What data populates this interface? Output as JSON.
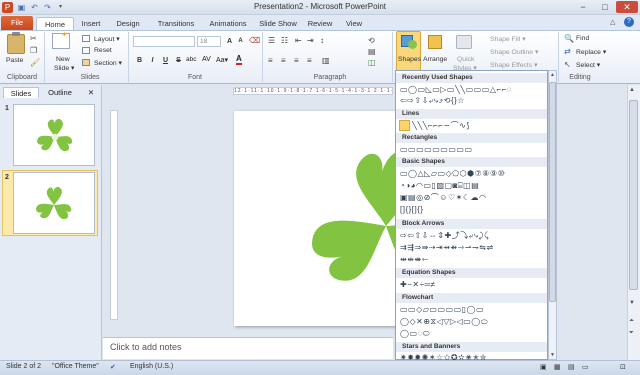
{
  "titlebar": {
    "title": "Presentation2 - Microsoft PowerPoint",
    "minimize": "−",
    "maximize": "□",
    "close": "✕"
  },
  "tabs": {
    "file": "File",
    "home": "Home",
    "insert": "Insert",
    "design": "Design",
    "transitions": "Transitions",
    "animations": "Animations",
    "slideshow": "Slide Show",
    "review": "Review",
    "view": "View"
  },
  "ribbon": {
    "clipboard": {
      "paste": "Paste",
      "label": "Clipboard"
    },
    "slides": {
      "new_slide_1": "New",
      "new_slide_2": "Slide ▾",
      "layout": "Layout ▾",
      "reset": "Reset",
      "section": "Section ▾",
      "label": "Slides"
    },
    "font": {
      "size": "18",
      "label": "Font",
      "bold": "B",
      "italic": "I",
      "underline": "U",
      "strike": "S",
      "shadow": "abc",
      "aa": "Aa▾",
      "grow": "A",
      "shrink": "A"
    },
    "paragraph": {
      "label": "Paragraph"
    },
    "drawing": {
      "shapes": "Shapes",
      "arrange": "Arrange",
      "quick_styles_1": "Quick",
      "quick_styles_2": "Styles ▾",
      "shape_fill": "Shape Fill ▾",
      "shape_outline": "Shape Outline ▾",
      "shape_effects": "Shape Effects ▾"
    },
    "editing": {
      "find": "Find",
      "replace": "Replace ▾",
      "select": "Select ▾",
      "label": "Editing"
    }
  },
  "slides_pane": {
    "tab_slides": "Slides",
    "tab_outline": "Outline",
    "close": "✕",
    "slide1": "1",
    "slide2": "2"
  },
  "ruler": {
    "text": "12·1·11·1·10·1·9·1·8·1·7·1·6·1·5·1·4·1·3·1·2·1·1·1·0"
  },
  "notes": {
    "placeholder": "Click to add notes"
  },
  "shapes_menu": {
    "recently_used": "Recently Used Shapes",
    "lines": "Lines",
    "rectangles": "Rectangles",
    "basic": "Basic Shapes",
    "block_arrows": "Block Arrows",
    "equation": "Equation Shapes",
    "flowchart": "Flowchart",
    "stars": "Stars and Banners",
    "rows": {
      "recent1": "▭◯▭◺▭▷▭╲╲▭▭▭△⌐⌐◌",
      "recent2": "⇦⇨⇧⇩⤶⤷⤴⟲{}☆",
      "lines": "╲╲╲⌐⌐⌐∼⌒∿⟆",
      "rects": "▭▭▭▭▭▭▭▭▭",
      "basic1": "▭◯△◺▱▭◇⬠⬡⬢⑦⑧⑨⑩",
      "basic2": "◔◑◕◠▭▯▨▢◙⌸◫▤",
      "basic3": "▣▤◎⊘⌒☺♡✶☾☁◠",
      "basic4": "[]{}[]{}",
      "arrows1": "⇨⇦⇧⇩⇔⇕✚⤴⤵⤶⤷⤸⤹",
      "arrows2": "⇉⇶⇒⇛⇢⇥⇸⇻⇾⇀⇁⇋⇌",
      "arrows3": "⇹⇺⇼⇽",
      "equation": "✚−✕÷═≠",
      "flow1": "▭▭◇▱▭▭▭▭▯◯▭",
      "flow2": "◯◇✕⊕⧖◁▽▷◁▭◯⬭",
      "flow3": "◯▭◌⬭",
      "stars": "✷✸✹✺✶☆✩✪✫✬✭✮"
    }
  },
  "status": {
    "slide": "Slide 2 of 2",
    "theme": "\"Office Theme\"",
    "language": "English (U.S.)"
  },
  "colors": {
    "clover": "#82c341",
    "file_tab": "#d2542a",
    "accent": "#2b579a"
  }
}
